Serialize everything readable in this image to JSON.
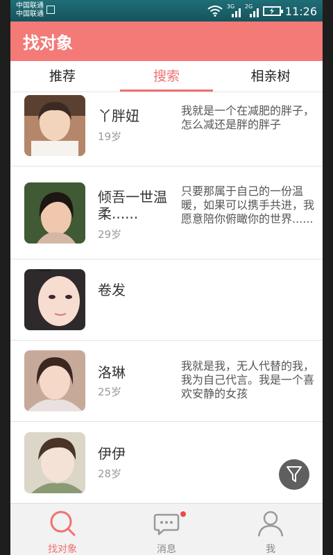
{
  "status_bar": {
    "carrier_1": "中国联通",
    "carrier_2": "中国联通",
    "network_1": "3G",
    "network_2": "2G",
    "time": "11:26",
    "icons": [
      "image-icon",
      "wifi-icon",
      "signal-icon",
      "signal-icon",
      "battery-charging-icon"
    ]
  },
  "app_bar": {
    "title": "找对象"
  },
  "tabs": [
    {
      "label": "推荐",
      "selected": false
    },
    {
      "label": "搜索",
      "selected": true
    },
    {
      "label": "相亲树",
      "selected": false
    }
  ],
  "profiles": [
    {
      "name": "丫胖妞",
      "age": "19岁",
      "bio": "我就是一个在减肥的胖子，怎么减还是胖的胖子"
    },
    {
      "name": "倾吾一世温柔......",
      "age": "29岁",
      "bio": "只要那属于自己的一份温暖，如果可以携手共进，我愿意陪你俯瞰你的世界......"
    },
    {
      "name": "卷发",
      "age": "",
      "bio": ""
    },
    {
      "name": "洛琳",
      "age": "25岁",
      "bio": "我就是我，无人代替的我，我为自己代言。我是一个喜欢安静的女孩"
    },
    {
      "name": "伊伊",
      "age": "28岁",
      "bio": ""
    }
  ],
  "filter_button": {
    "icon": "filter-funnel-icon"
  },
  "bottom_nav": [
    {
      "label": "找对象",
      "icon": "search-icon",
      "active": true
    },
    {
      "label": "消息",
      "icon": "chat-bubble-icon",
      "has_badge": true
    },
    {
      "label": "我",
      "icon": "person-icon"
    }
  ],
  "colors": {
    "accent": "#f37a77",
    "status_bar": "#15545c",
    "active_tab": "#f0706f",
    "badge": "#f04848"
  }
}
